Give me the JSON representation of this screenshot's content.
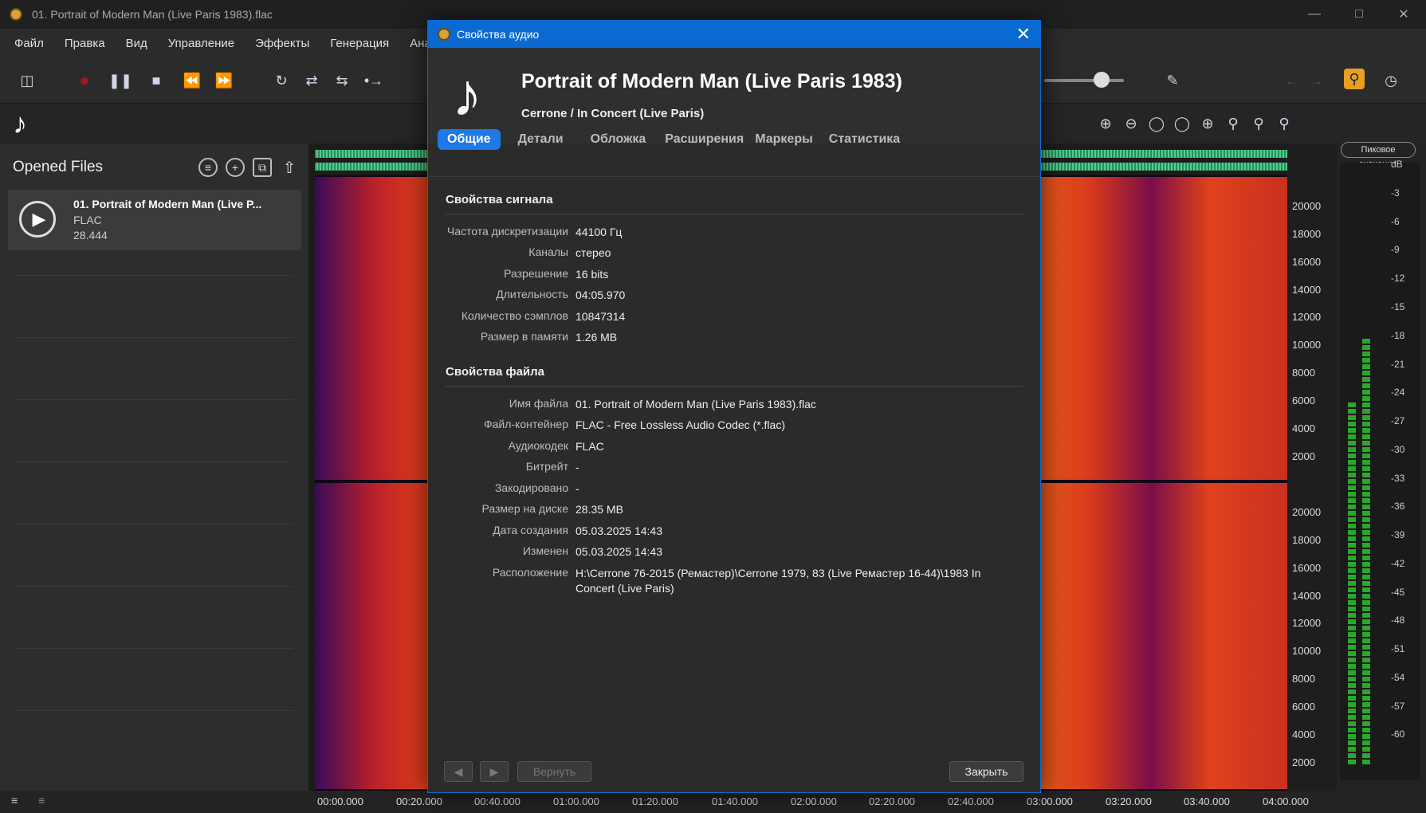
{
  "window": {
    "title": "01. Portrait of Modern Man (Live Paris 1983).flac",
    "minimize_icon": "minimize-icon",
    "maximize_icon": "maximize-icon",
    "close_icon": "close-icon"
  },
  "menu": [
    "Файл",
    "Правка",
    "Вид",
    "Управление",
    "Эффекты",
    "Генерация",
    "Анали"
  ],
  "left_panel": {
    "title": "Opened Files",
    "file": {
      "name": "01. Portrait of Modern Man (Live P...",
      "format": "FLAC",
      "size": "28.444"
    }
  },
  "freq_axis": [
    "20000",
    "18000",
    "16000",
    "14000",
    "12000",
    "10000",
    "8000",
    "6000",
    "4000",
    "2000"
  ],
  "meter": {
    "title": "Пиковое значение",
    "unit": "dB",
    "scale": [
      "-3",
      "-6",
      "-9",
      "-12",
      "-15",
      "-18",
      "-21",
      "-24",
      "-27",
      "-30",
      "-33",
      "-36",
      "-39",
      "-42",
      "-45",
      "-48",
      "-51",
      "-54",
      "-57",
      "-60"
    ]
  },
  "timeline": [
    "00:00.000",
    "00:20.000",
    "00:40.000",
    "01:00.000",
    "01:20.000",
    "01:40.000",
    "02:00.000",
    "02:20.000",
    "02:40.000",
    "03:00.000",
    "03:20.000",
    "03:40.000",
    "04:00.000"
  ],
  "dialog": {
    "title": "Свойства аудио",
    "track_title": "Portrait of Modern Man (Live Paris 1983)",
    "subtitle": "Cerrone / In Concert (Live Paris)",
    "tabs": [
      "Общие",
      "Детали",
      "Обложка",
      "Расширения",
      "Маркеры",
      "Статистика"
    ],
    "signal_section": "Свойства сигнала",
    "signal": [
      {
        "k": "Частота дискретизации",
        "v": "44100 Гц"
      },
      {
        "k": "Каналы",
        "v": "стерео"
      },
      {
        "k": "Разрешение",
        "v": "16 bits"
      },
      {
        "k": "Длительность",
        "v": "04:05.970"
      },
      {
        "k": "Количество сэмплов",
        "v": "10847314"
      },
      {
        "k": "Размер в памяти",
        "v": "1.26 MB"
      }
    ],
    "file_section": "Свойства файла",
    "file": [
      {
        "k": "Имя файла",
        "v": "01. Portrait of Modern Man (Live Paris 1983).flac"
      },
      {
        "k": "Файл-контейнер",
        "v": "FLAC - Free Lossless Audio Codec (*.flac)"
      },
      {
        "k": "Аудиокодек",
        "v": "FLAC"
      },
      {
        "k": "Битрейт",
        "v": "-"
      },
      {
        "k": "Закодировано",
        "v": "-"
      },
      {
        "k": "Размер на диске",
        "v": "28.35 MB"
      },
      {
        "k": "Дата создания",
        "v": "05.03.2025 14:43"
      },
      {
        "k": "Изменен",
        "v": "05.03.2025 14:43"
      },
      {
        "k": "Расположение",
        "v": "H:\\Cerrone 76-2015 (Ремастер)\\Cerrone 1979, 83 (Live Ремастер 16-44)\\1983 In Concert (Live Paris)"
      }
    ],
    "revert_label": "Вернуть",
    "close_label": "Закрыть"
  }
}
